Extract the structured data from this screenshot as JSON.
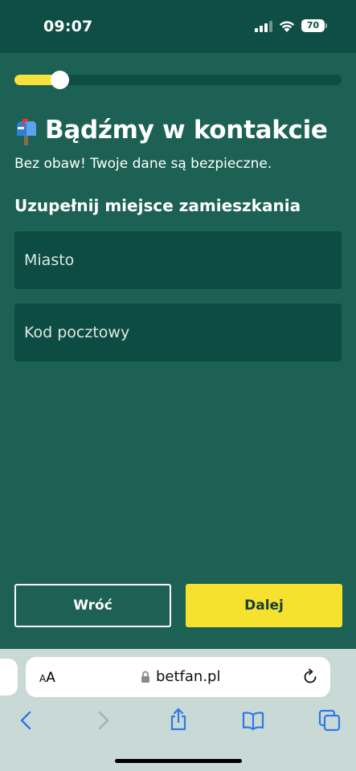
{
  "status_bar": {
    "time": "09:07",
    "battery": "70"
  },
  "progress": {
    "fraction": 0.14
  },
  "header": {
    "icon": "mailbox-icon",
    "title": "Bądźmy w kontakcie",
    "subtitle": "Bez obaw! Twoje dane są bezpieczne."
  },
  "form": {
    "section_title": "Uzupełnij miejsce zamieszkania",
    "city_placeholder": "Miasto",
    "city_value": "",
    "zip_placeholder": "Kod pocztowy",
    "zip_value": ""
  },
  "actions": {
    "back_label": "Wróć",
    "next_label": "Dalej"
  },
  "browser": {
    "text_size_label_small": "A",
    "text_size_label_large": "A",
    "url": "betfan.pl"
  },
  "colors": {
    "background": "#1c6153",
    "field": "#0c4c42",
    "accent": "#f6e12e"
  }
}
